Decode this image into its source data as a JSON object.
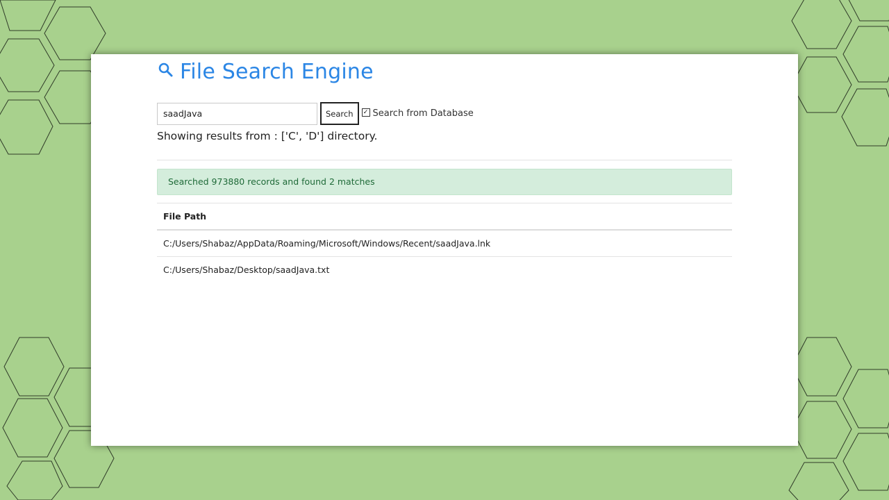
{
  "colors": {
    "background": "#a8d18d",
    "title": "#2b86e5",
    "alert_bg": "#d4eddc",
    "alert_text": "#1f6a38"
  },
  "header": {
    "icon": "search-icon",
    "title": "File Search Engine"
  },
  "search": {
    "value": "saadJava",
    "button_label": "Search",
    "checkbox_label": "Search from Database",
    "checkbox_checked": true
  },
  "showing_text": "Showing results from : ['C', 'D'] directory.",
  "alert": {
    "text": "Searched 973880 records and found 2 matches"
  },
  "results": {
    "column_header": "File Path",
    "rows": [
      "C:/Users/Shabaz/AppData/Roaming/Microsoft/Windows/Recent/saadJava.lnk",
      "C:/Users/Shabaz/Desktop/saadJava.txt"
    ]
  }
}
